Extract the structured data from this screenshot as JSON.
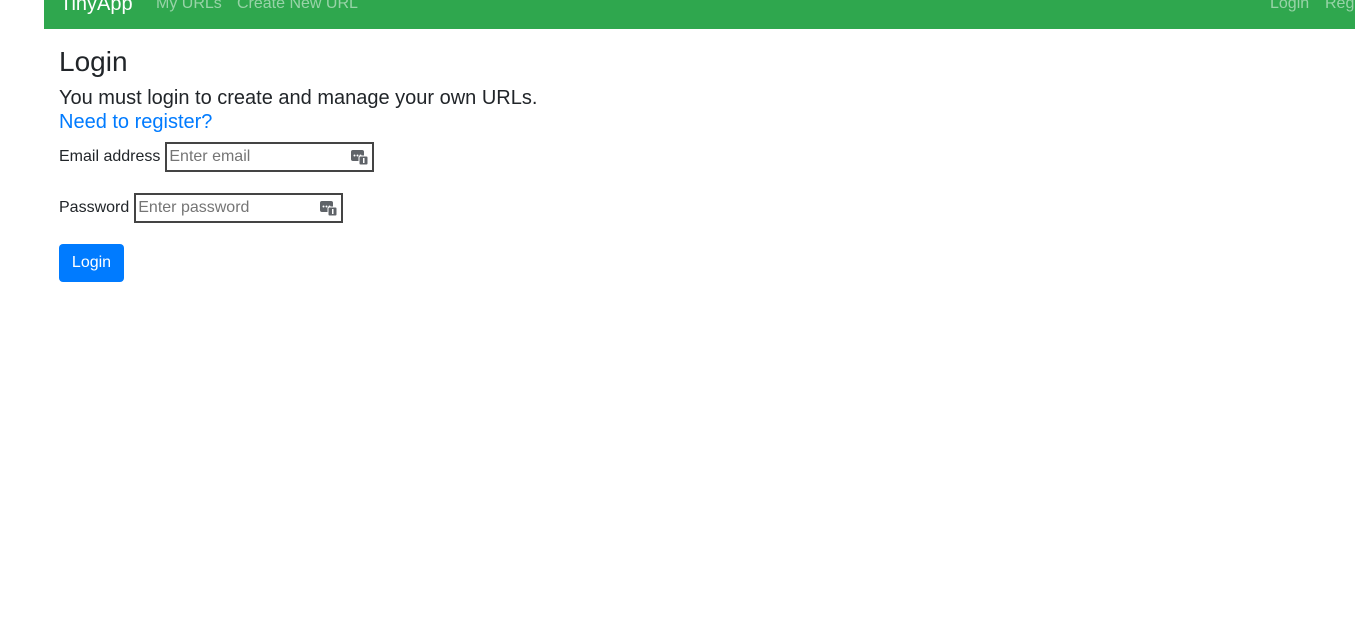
{
  "navbar": {
    "brand": "TinyApp",
    "left_links": [
      "My URLs",
      "Create New URL"
    ],
    "right_links": [
      "Login",
      "Register"
    ],
    "color": "#2fa74e"
  },
  "main": {
    "title": "Login",
    "subtitle": "You must login to create and manage your own URLs.",
    "register_link": "Need to register?",
    "email": {
      "label": "Email address",
      "placeholder": "Enter email",
      "value": "",
      "icon": "password-manager-icon"
    },
    "password": {
      "label": "Password",
      "placeholder": "Enter password",
      "value": "",
      "icon": "password-manager-icon"
    },
    "submit_label": "Login"
  },
  "colors": {
    "accent": "#007bff",
    "navbar": "#2fa74e"
  }
}
